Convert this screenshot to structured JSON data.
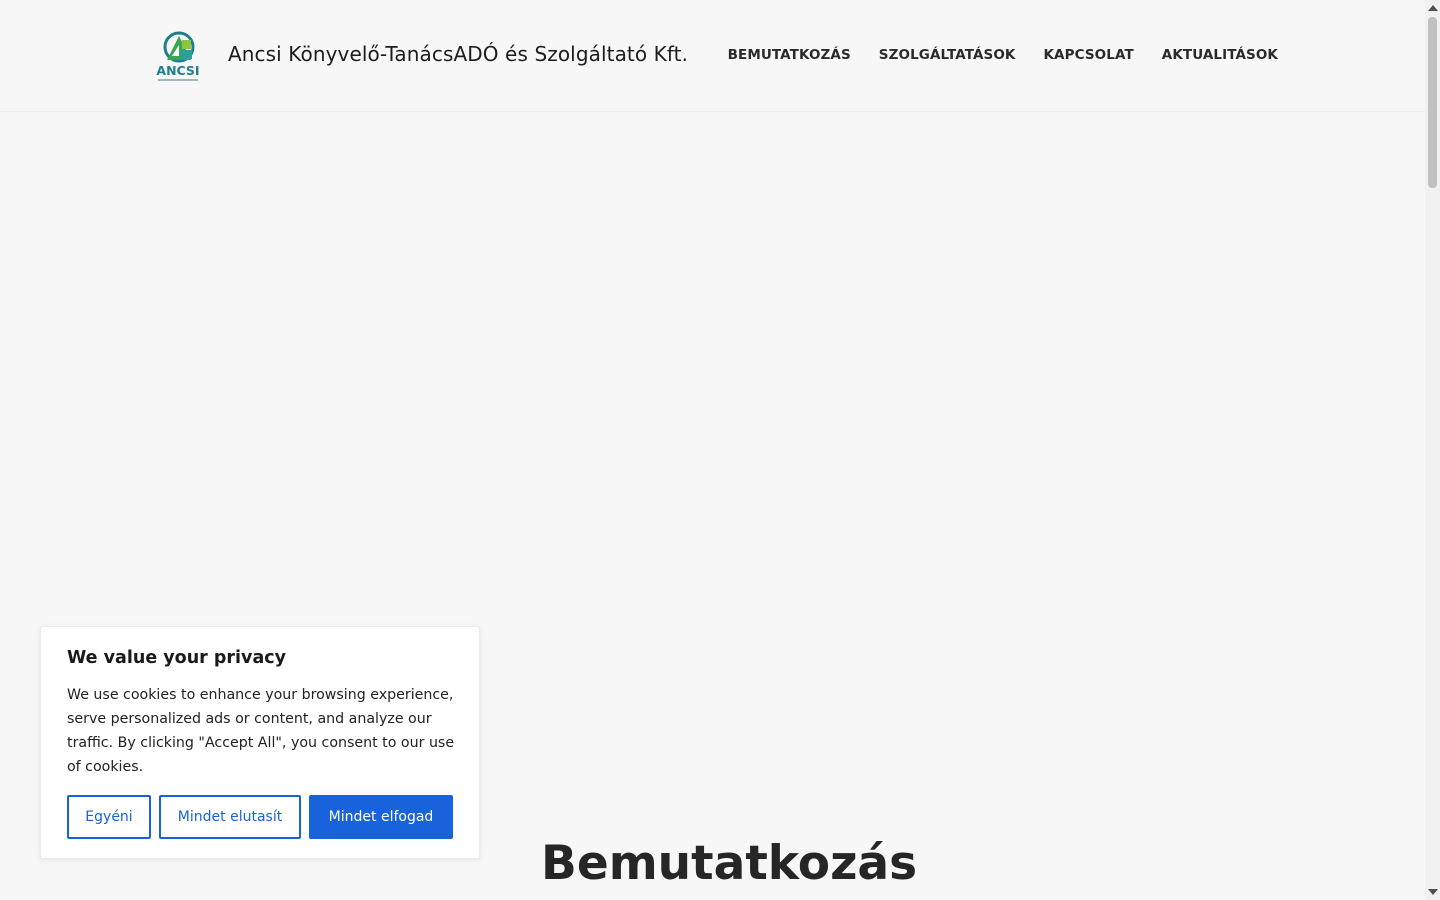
{
  "header": {
    "site_title": "Ancsi Könyvelő-TanácsADÓ és Szolgáltató Kft.",
    "logo_text": "ANCSI",
    "nav": [
      {
        "label": "BEMUTATKOZÁS"
      },
      {
        "label": "SZOLGÁLTATÁSOK"
      },
      {
        "label": "KAPCSOLAT"
      },
      {
        "label": "AKTUALITÁSOK"
      }
    ]
  },
  "main": {
    "section_title": "Bemutatkozás"
  },
  "cookie_banner": {
    "title": "We value your privacy",
    "body": "We use cookies to enhance your browsing experience, serve personalized ads or content, and analyze our traffic. By clicking \"Accept All\", you consent to our use of cookies.",
    "customize_label": "Egyéni",
    "reject_label": "Mindet elutasít",
    "accept_label": "Mindet elfogad"
  },
  "colors": {
    "accent": "#1863dc",
    "background": "#f7f7f7",
    "logo_green": "#3aa655",
    "logo_teal": "#1f7f8c"
  }
}
